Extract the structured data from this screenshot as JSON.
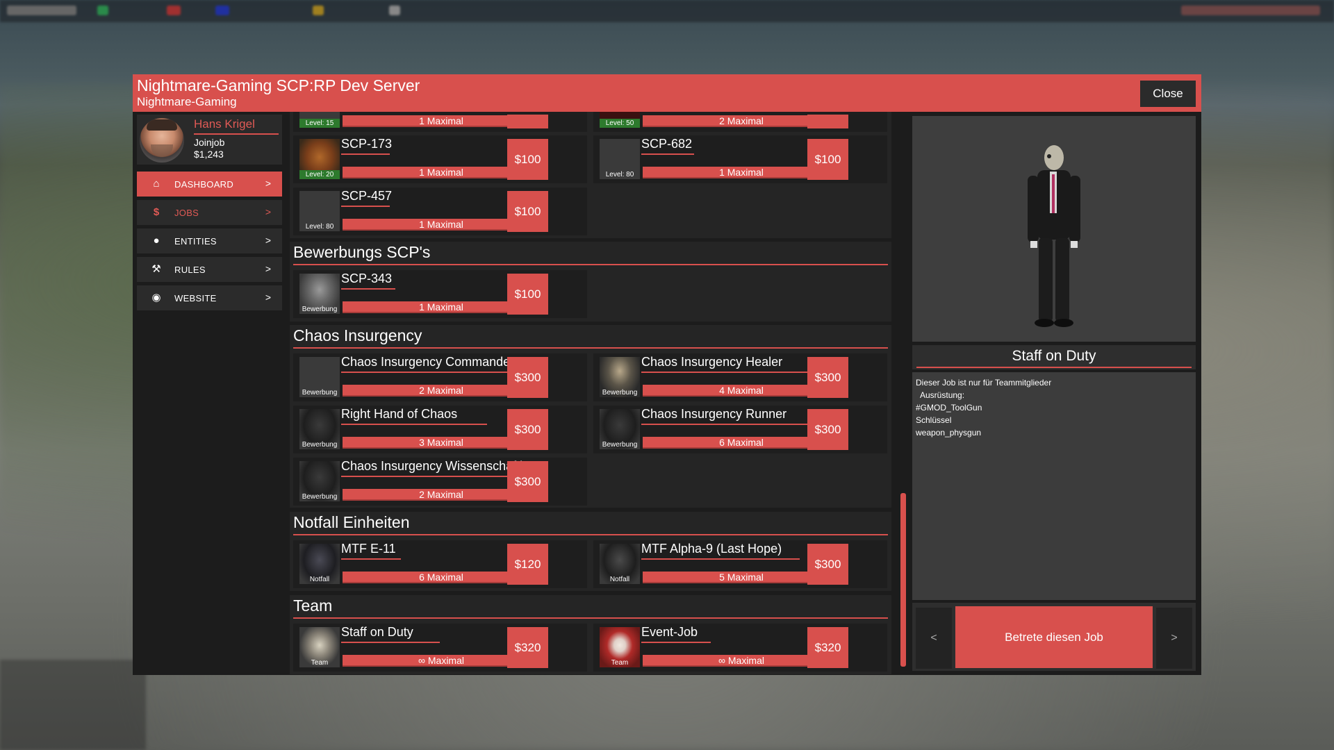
{
  "window": {
    "title": "Nightmare-Gaming SCP:RP Dev Server",
    "subtitle": "Nightmare-Gaming",
    "close_label": "Close"
  },
  "profile": {
    "name": "Hans Krigel",
    "job": "Joinjob",
    "money": "$1,243"
  },
  "nav": [
    {
      "label": "DASHBOARD",
      "icon": "home-icon",
      "chevron": ">"
    },
    {
      "label": "JOBS",
      "icon": "dollar-icon",
      "chevron": ">"
    },
    {
      "label": "ENTITIES",
      "icon": "bomb-icon",
      "chevron": ">"
    },
    {
      "label": "RULES",
      "icon": "gavel-icon",
      "chevron": ">"
    },
    {
      "label": "WEBSITE",
      "icon": "globe-icon",
      "chevron": ">"
    }
  ],
  "categories": {
    "top": {
      "jobs": [
        {
          "tag": "Level: 15",
          "max": "1 Maximal"
        },
        {
          "tag": "Level: 50",
          "max": "2 Maximal"
        },
        {
          "name": "SCP-173",
          "tag": "Level: 20",
          "max": "1 Maximal",
          "price": "$100"
        },
        {
          "name": "SCP-682",
          "tag": "Level: 80",
          "max": "1 Maximal",
          "price": "$100"
        },
        {
          "name": "SCP-457",
          "tag": "Level: 80",
          "max": "1 Maximal",
          "price": "$100"
        }
      ]
    },
    "bewerbung": {
      "title": "Bewerbungs SCP's",
      "jobs": [
        {
          "name": "SCP-343",
          "tag": "Bewerbung",
          "max": "1 Maximal",
          "price": "$100"
        }
      ]
    },
    "chaos": {
      "title": "Chaos Insurgency",
      "jobs": [
        {
          "name": "Chaos Insurgency Commander",
          "tag": "Bewerbung",
          "max": "2 Maximal",
          "price": "$300"
        },
        {
          "name": "Chaos Insurgency Healer",
          "tag": "Bewerbung",
          "max": "4 Maximal",
          "price": "$300"
        },
        {
          "name": "Right Hand of Chaos",
          "tag": "Bewerbung",
          "max": "3 Maximal",
          "price": "$300"
        },
        {
          "name": "Chaos Insurgency Runner",
          "tag": "Bewerbung",
          "max": "6 Maximal",
          "price": "$300"
        },
        {
          "name": "Chaos Insurgency Wissenschaftler",
          "tag": "Bewerbung",
          "max": "2 Maximal",
          "price": "$300"
        }
      ]
    },
    "notfall": {
      "title": "Notfall Einheiten",
      "jobs": [
        {
          "name": "MTF E-11",
          "tag": "Notfall",
          "max": "6 Maximal",
          "price": "$120"
        },
        {
          "name": "MTF Alpha-9 (Last Hope)",
          "tag": "Notfall",
          "max": "5 Maximal",
          "price": "$300"
        }
      ]
    },
    "team": {
      "title": "Team",
      "jobs": [
        {
          "name": "Staff on Duty",
          "tag": "Team",
          "max": "∞ Maximal",
          "price": "$320"
        },
        {
          "name": "Event-Job",
          "tag": "Team",
          "max": "∞ Maximal",
          "price": "$320"
        }
      ]
    }
  },
  "selected_job": {
    "title": "Staff on Duty",
    "description": [
      "Dieser Job ist nur für Teammitglieder",
      "",
      "  Ausrüstung:",
      "#GMOD_ToolGun",
      "Schlüssel",
      "weapon_physgun"
    ],
    "join_label": "Betrete diesen Job",
    "prev_label": "<",
    "next_label": ">"
  },
  "colors": {
    "accent": "#d8504d",
    "panel": "#1c1c1c",
    "card": "#1e1e1e"
  }
}
